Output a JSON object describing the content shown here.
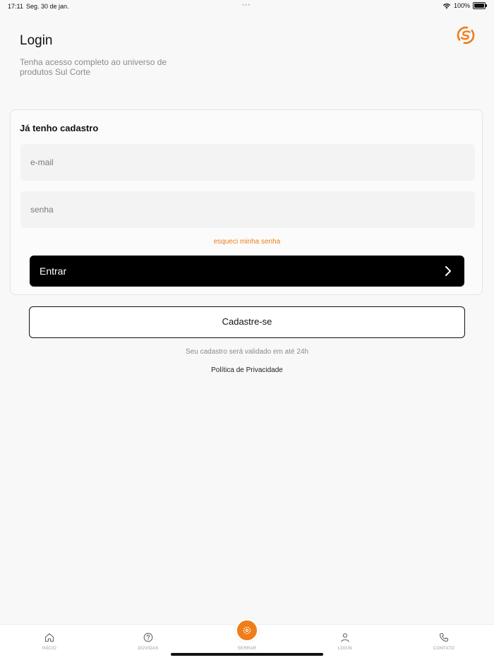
{
  "status_bar": {
    "time": "17:11",
    "date": "Seg. 30 de jan.",
    "battery": "100%"
  },
  "header": {
    "title": "Login",
    "subtitle": "Tenha acesso completo ao universo de produtos Sul Corte"
  },
  "login_card": {
    "title": "Já tenho cadastro",
    "email_placeholder": "e-mail",
    "password_placeholder": "senha",
    "forgot_password": "esqueci minha senha",
    "submit_label": "Entrar"
  },
  "register": {
    "button_label": "Cadastre-se",
    "note": "Seu cadastro será validado em até 24h",
    "privacy_link": "Política de Privacidade"
  },
  "tab_bar": {
    "items": [
      {
        "label": "INÍCIO",
        "icon": "home-icon"
      },
      {
        "label": "DÚVIDAS",
        "icon": "help-icon"
      },
      {
        "label": "SERRAR",
        "icon": "saw-icon"
      },
      {
        "label": "LOGIN",
        "icon": "user-icon"
      },
      {
        "label": "CONTATO",
        "icon": "phone-icon"
      }
    ]
  },
  "colors": {
    "accent": "#ef7d1a",
    "primary_button": "#000000",
    "background": "#f8f8f8"
  }
}
